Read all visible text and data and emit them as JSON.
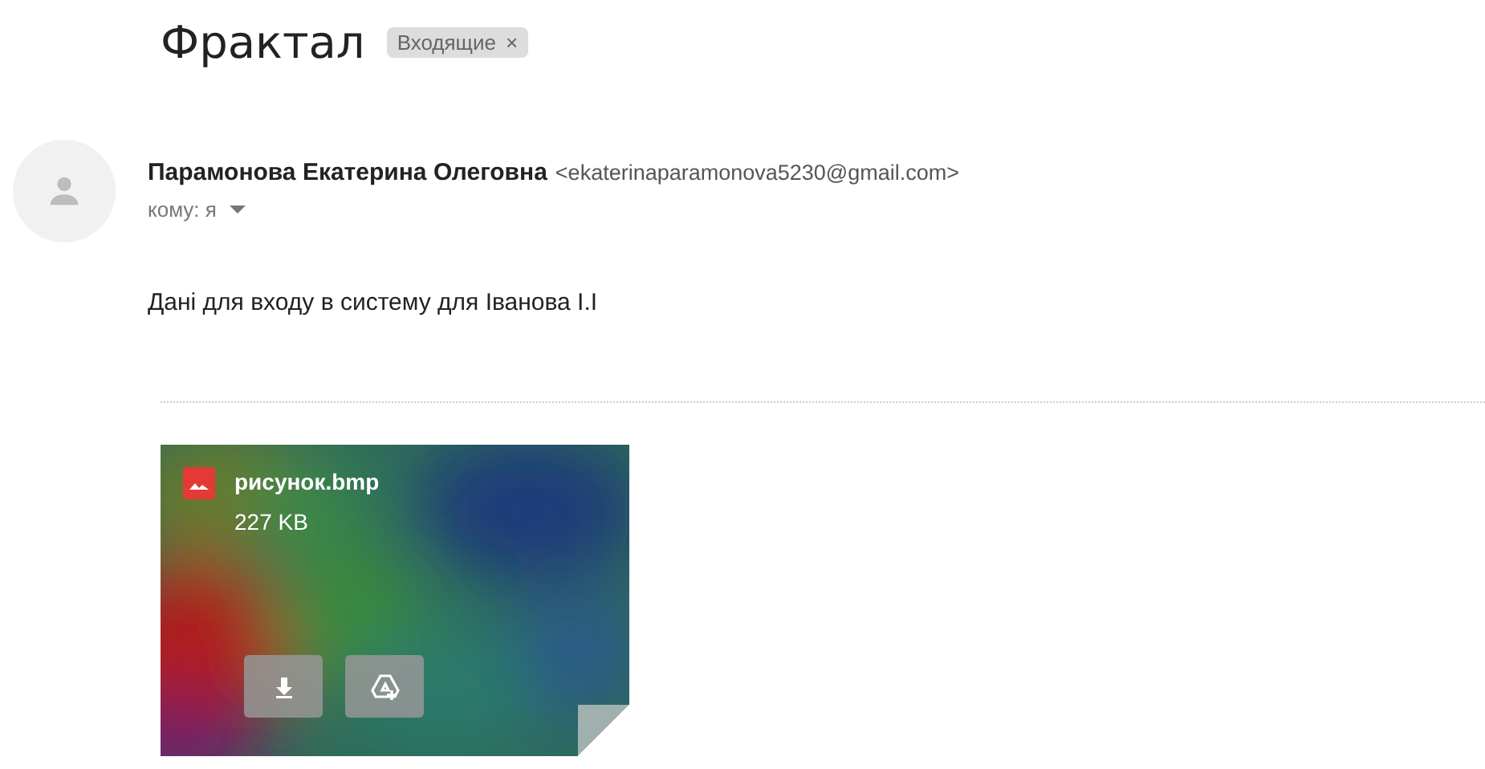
{
  "subject": "Фрактал",
  "label": {
    "text": "Входящие",
    "close": "×"
  },
  "message": {
    "sender_name": "Парамонова Екатерина Олеговна",
    "sender_email": "<ekaterinaparamonova5230@gmail.com>",
    "recipient": "кому: я",
    "body": "Дані для входу в систему для Іванова І.І"
  },
  "attachment": {
    "kind": "picture",
    "name": "рисунок.bmp",
    "size": "227 KB"
  }
}
